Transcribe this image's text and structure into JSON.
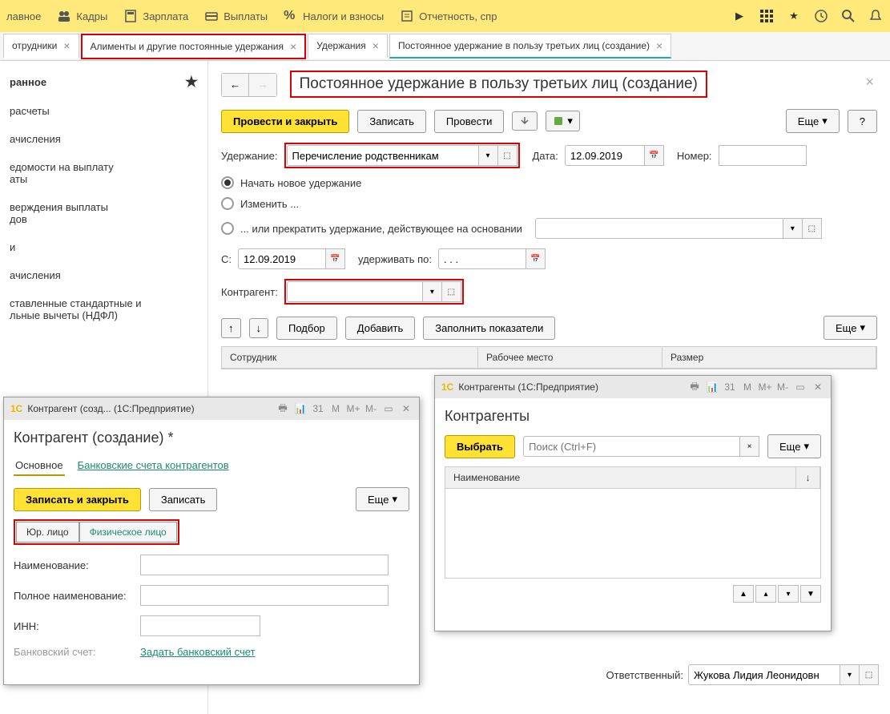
{
  "toolbar": {
    "items": [
      "лавное",
      "Кадры",
      "Зарплата",
      "Выплаты",
      "Налоги и взносы",
      "Отчетность, спр"
    ]
  },
  "tabs": [
    {
      "label": "отрудники"
    },
    {
      "label": "Алименты и другие постоянные удержания"
    },
    {
      "label": "Удержания"
    },
    {
      "label": "Постоянное удержание в пользу третьих лиц (создание)"
    }
  ],
  "sidebar": {
    "title": "ранное",
    "items": [
      "расчеты",
      "ачисления",
      "едомости на выплату\nаты",
      "верждения выплаты\nдов",
      "и",
      "ачисления",
      "ставленные стандартные и\nльные вычеты (НДФЛ)"
    ]
  },
  "page": {
    "title": "Постоянное удержание в пользу третьих лиц (создание)",
    "btn_post_close": "Провести и закрыть",
    "btn_write": "Записать",
    "btn_post": "Провести",
    "btn_more": "Еще",
    "btn_help": "?",
    "lbl_deduction": "Удержание:",
    "val_deduction": "Перечисление родственникам",
    "lbl_date": "Дата:",
    "val_date": "12.09.2019",
    "lbl_number": "Номер:",
    "val_number": "",
    "radio1": "Начать новое удержание",
    "radio2": "Изменить ...",
    "radio3": "... или прекратить удержание, действующее на основании",
    "lbl_from": "С:",
    "val_from": "12.09.2019",
    "lbl_until": "удерживать по:",
    "val_until": ". . .",
    "lbl_counterparty": "Контрагент:",
    "val_counterparty": "",
    "btn_select": "Подбор",
    "btn_add": "Добавить",
    "btn_fill": "Заполнить показатели",
    "col1": "Сотрудник",
    "col2": "Рабочее место",
    "col3": "Размер",
    "lbl_responsible": "Ответственный:",
    "val_responsible": "Жукова Лидия Леонидовн"
  },
  "dialog1": {
    "wintitle": "Контрагент (созд...  (1С:Предприятие)",
    "heading": "Контрагент (создание) *",
    "tab1": "Основное",
    "tab2": "Банковские счета контрагентов",
    "btn_save_close": "Записать и закрыть",
    "btn_write": "Записать",
    "btn_more": "Еще",
    "tb1": "Юр. лицо",
    "tb2": "Физическое лицо",
    "lbl_name": "Наименование:",
    "lbl_fullname": "Полное наименование:",
    "lbl_inn": "ИНН:",
    "lbl_bank": "Банковский счет:",
    "link_bank": "Задать банковский счет"
  },
  "dialog2": {
    "wintitle": "Контрагенты (1С:Предприятие)",
    "heading": "Контрагенты",
    "btn_choose": "Выбрать",
    "search_ph": "Поиск (Ctrl+F)",
    "btn_more": "Еще",
    "col_name": "Наименование"
  }
}
